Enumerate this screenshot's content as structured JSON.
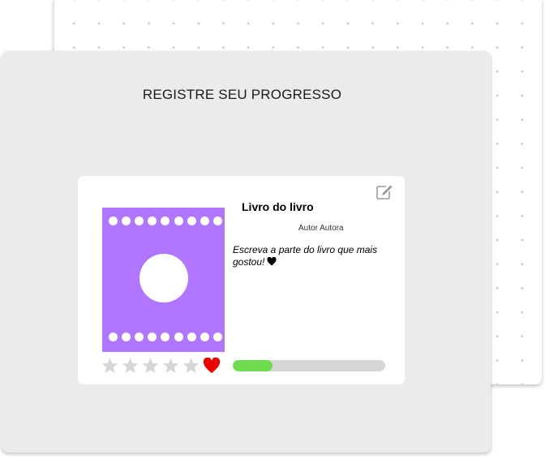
{
  "page": {
    "title": "REGISTRE SEU PROGRESSO"
  },
  "book": {
    "title": "Livro do livro",
    "author": "Autor Autora",
    "favorite_quote": "Escreva a parte do livro que mais gostou!",
    "cover_color": "#b076ff",
    "rating": {
      "stars_filled": 0,
      "stars_total": 5,
      "favorite": true,
      "favorite_color": "#ee0000"
    },
    "progress": {
      "fraction": 0.26,
      "color": "#6fdb4e"
    }
  },
  "icons": {
    "edit": "edit-icon",
    "star": "star-icon",
    "heart": "heart-icon"
  }
}
